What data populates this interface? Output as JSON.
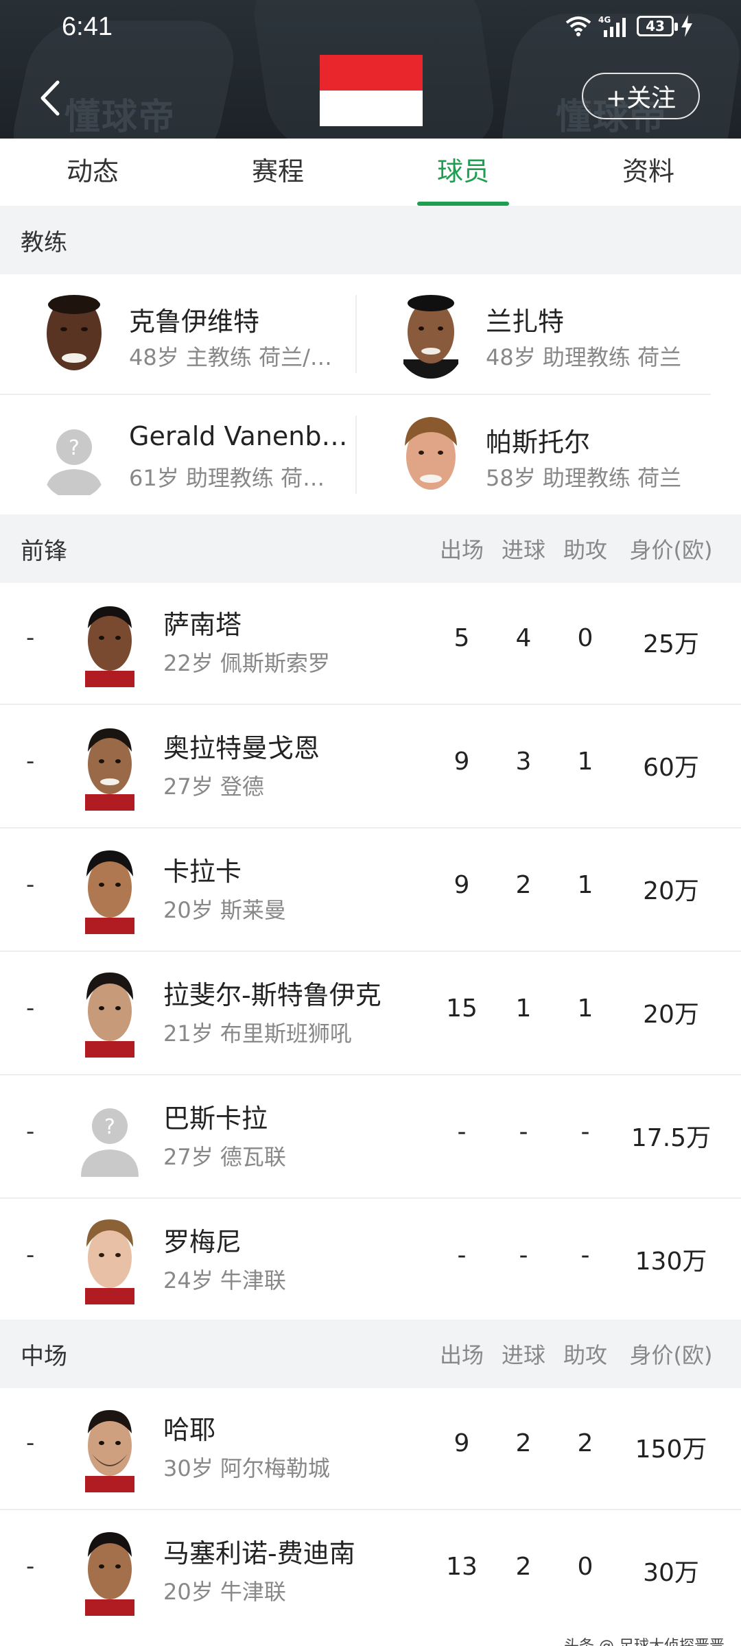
{
  "status_bar": {
    "time": "6:41",
    "battery": "43",
    "network": "4G"
  },
  "header": {
    "follow_label": "+关注",
    "watermark": "懂球帝"
  },
  "flag_colors": {
    "top": "#e8262c",
    "bottom": "#ffffff"
  },
  "accent_color": "#1e9e4f",
  "tabs": [
    {
      "label": "动态"
    },
    {
      "label": "赛程"
    },
    {
      "label": "球员",
      "active": true
    },
    {
      "label": "资料"
    }
  ],
  "coaches": {
    "title": "教练",
    "items": [
      {
        "name": "克鲁伊维特",
        "info": "48岁 主教练 荷兰/…",
        "avatar": "coach-photo"
      },
      {
        "name": "兰扎特",
        "info": "48岁 助理教练 荷兰",
        "avatar": "coach-photo"
      },
      {
        "name": "Gerald Vanenb…",
        "info": "61岁 助理教练 荷…",
        "avatar": "placeholder-person-icon"
      },
      {
        "name": "帕斯托尔",
        "info": "58岁 助理教练 荷兰",
        "avatar": "coach-photo"
      }
    ]
  },
  "columns": {
    "apps": "出场",
    "goals": "进球",
    "assists": "助攻",
    "value": "身价(欧)"
  },
  "forwards": {
    "title": "前锋",
    "players": [
      {
        "num": "-",
        "name": "萨南塔",
        "info": "22岁 佩斯斯索罗",
        "apps": "5",
        "goals": "4",
        "assists": "0",
        "value": "25万"
      },
      {
        "num": "-",
        "name": "奥拉特曼戈恩",
        "info": "27岁 登德",
        "apps": "9",
        "goals": "3",
        "assists": "1",
        "value": "60万"
      },
      {
        "num": "-",
        "name": "卡拉卡",
        "info": "20岁 斯莱曼",
        "apps": "9",
        "goals": "2",
        "assists": "1",
        "value": "20万"
      },
      {
        "num": "-",
        "name": "拉斐尔-斯特鲁伊克",
        "info": "21岁 布里斯班狮吼",
        "apps": "15",
        "goals": "1",
        "assists": "1",
        "value": "20万"
      },
      {
        "num": "-",
        "name": "巴斯卡拉",
        "info": "27岁 德瓦联",
        "apps": "-",
        "goals": "-",
        "assists": "-",
        "value": "17.5万",
        "placeholder": true
      },
      {
        "num": "-",
        "name": "罗梅尼",
        "info": "24岁 牛津联",
        "apps": "-",
        "goals": "-",
        "assists": "-",
        "value": "130万"
      }
    ]
  },
  "midfielders": {
    "title": "中场",
    "players": [
      {
        "num": "-",
        "name": "哈耶",
        "info": "30岁 阿尔梅勒城",
        "apps": "9",
        "goals": "2",
        "assists": "2",
        "value": "150万"
      },
      {
        "num": "-",
        "name": "马塞利诺-费迪南",
        "info": "20岁 牛津联",
        "apps": "13",
        "goals": "2",
        "assists": "0",
        "value": "30万"
      }
    ]
  },
  "footer": {
    "watermark": "头条 @ 足球大侦探晋晋"
  }
}
